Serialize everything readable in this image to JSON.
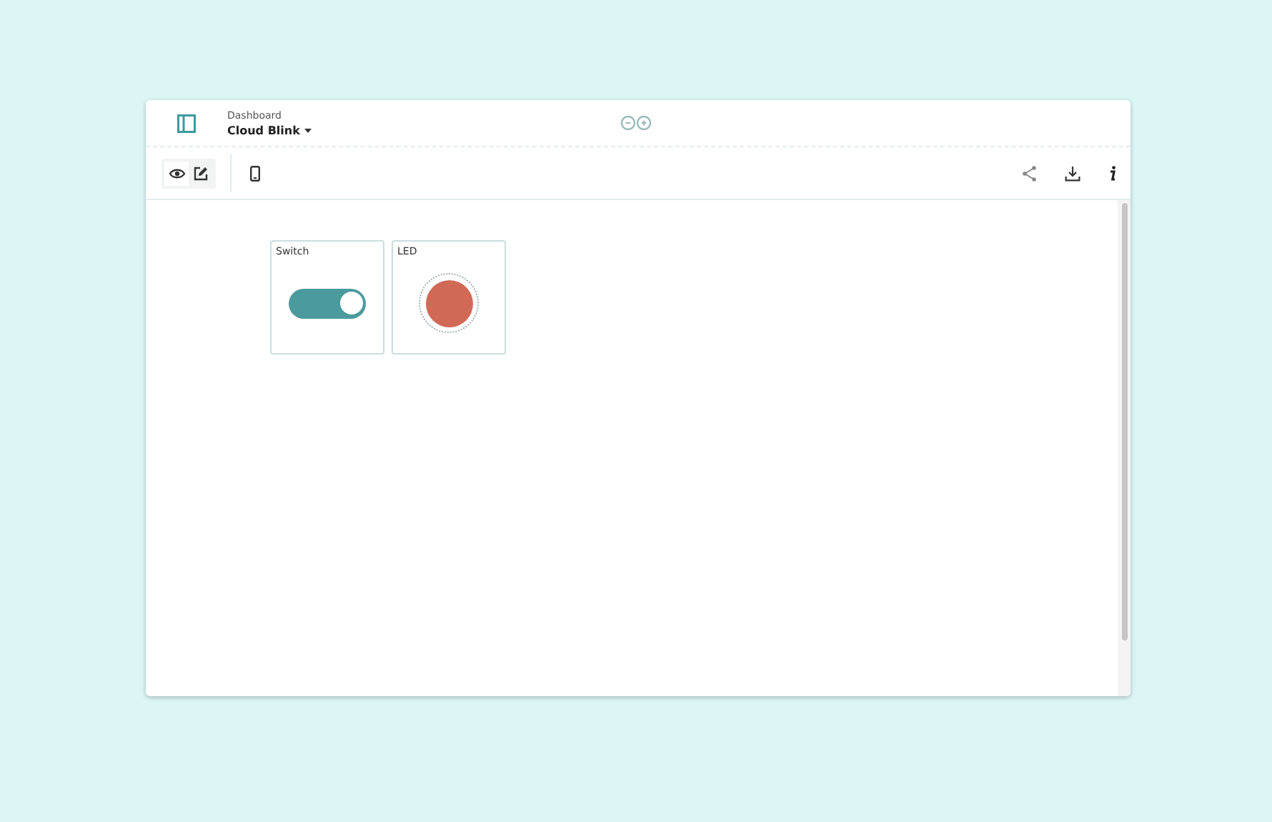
{
  "header": {
    "breadcrumb": "Dashboard",
    "title": "Cloud Blink"
  },
  "modes": [
    {
      "kind": "view",
      "selected": true
    },
    {
      "kind": "edit",
      "selected": false
    }
  ],
  "widgets": [
    {
      "kind": "switch",
      "label": "Switch",
      "on": true
    },
    {
      "kind": "led",
      "label": "LED",
      "on": true
    }
  ]
}
